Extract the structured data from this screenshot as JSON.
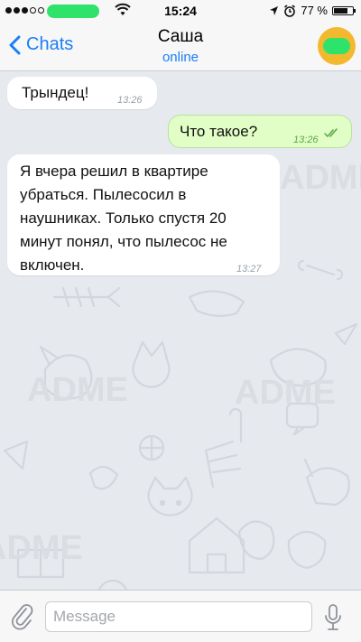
{
  "status_bar": {
    "time": "15:24",
    "battery": "77 %",
    "battery_level": 0.77
  },
  "header": {
    "back_label": "Chats",
    "contact_name": "Саша",
    "contact_status": "online"
  },
  "messages": [
    {
      "direction": "in",
      "text": "Трындец!",
      "time": "13:26"
    },
    {
      "direction": "out",
      "text": "Что такое?",
      "time": "13:26",
      "status": "read"
    },
    {
      "direction": "in",
      "lines": [
        "Я вчера решил в квартире",
        "убраться. Пылесосил в",
        "наушниках. Только спустя 20",
        "минут понял, что пылесос не",
        "включен."
      ],
      "time": "13:27"
    }
  ],
  "composer": {
    "placeholder": "Message",
    "value": ""
  },
  "watermark": "ADME",
  "colors": {
    "accent": "#1a7ef5",
    "outgoing_bubble": "#e1fec6",
    "incoming_bubble": "#ffffff",
    "chat_background": "#e6e9ee"
  }
}
